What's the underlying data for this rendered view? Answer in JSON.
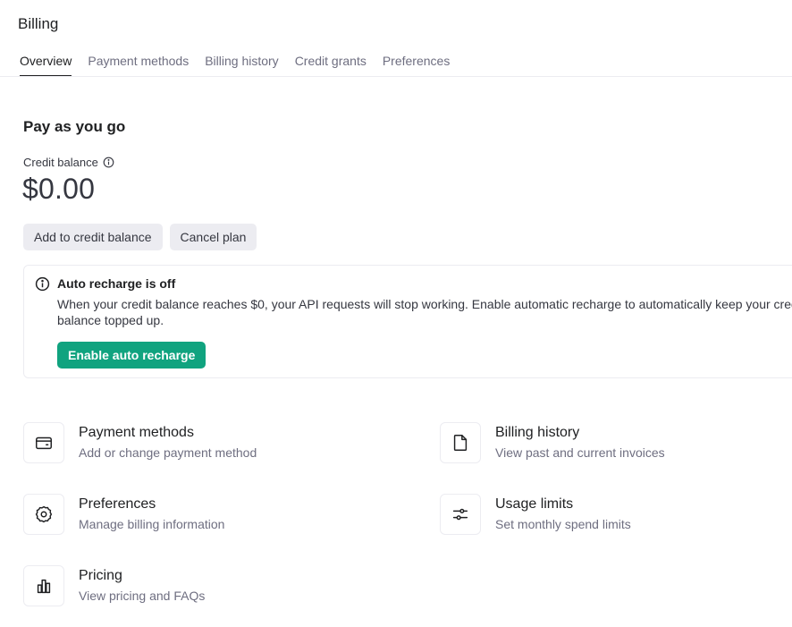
{
  "page": {
    "title": "Billing"
  },
  "tabs": [
    {
      "label": "Overview",
      "active": true
    },
    {
      "label": "Payment methods",
      "active": false
    },
    {
      "label": "Billing history",
      "active": false
    },
    {
      "label": "Credit grants",
      "active": false
    },
    {
      "label": "Preferences",
      "active": false
    }
  ],
  "plan": {
    "title": "Pay as you go",
    "credit_label": "Credit balance",
    "credit_amount": "$0.00",
    "add_credit_label": "Add to credit balance",
    "cancel_plan_label": "Cancel plan"
  },
  "notice": {
    "title": "Auto recharge is off",
    "body": "When your credit balance reaches $0, your API requests will stop working. Enable automatic recharge to automatically keep your credit balance topped up.",
    "button_label": "Enable auto recharge"
  },
  "cards": [
    {
      "title": "Payment methods",
      "description": "Add or change payment method",
      "icon": "credit-card-icon"
    },
    {
      "title": "Billing history",
      "description": "View past and current invoices",
      "icon": "document-icon"
    },
    {
      "title": "Preferences",
      "description": "Manage billing information",
      "icon": "gear-icon"
    },
    {
      "title": "Usage limits",
      "description": "Set monthly spend limits",
      "icon": "sliders-icon"
    },
    {
      "title": "Pricing",
      "description": "View pricing and FAQs",
      "icon": "bar-chart-icon"
    }
  ],
  "colors": {
    "accent": "#10a37f",
    "text_primary": "#202123",
    "text_secondary": "#6e6e80",
    "border": "#ececf1"
  }
}
